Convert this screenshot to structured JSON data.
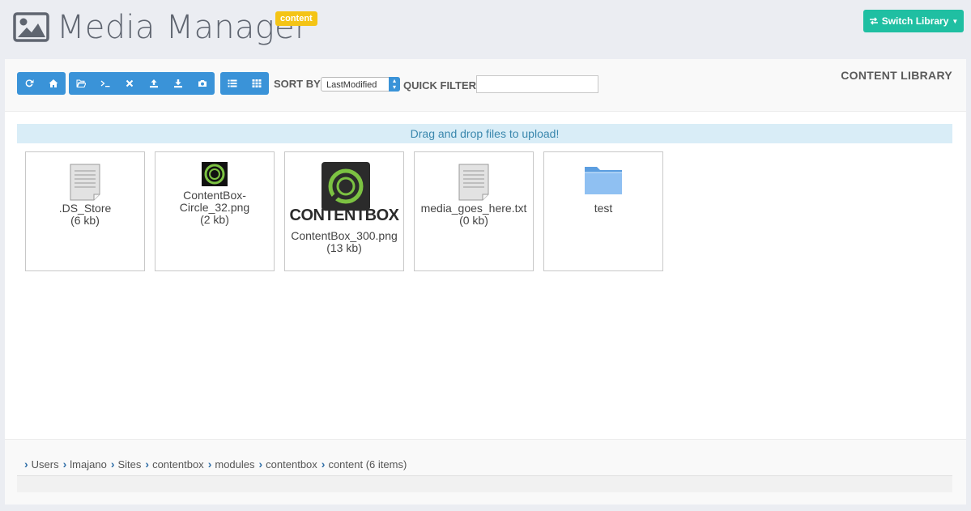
{
  "header": {
    "title": "Media Manager",
    "badge": "content",
    "switch_label": "Switch Library"
  },
  "toolbar": {
    "groups": [
      [
        "refresh-icon",
        "home-icon"
      ],
      [
        "folder-open-icon",
        "terminal-icon",
        "remove-icon",
        "upload-icon",
        "download-icon",
        "camera-icon"
      ],
      [
        "list-view-icon",
        "grid-view-icon"
      ]
    ],
    "sort_label": "SORT BY",
    "sort_value": "LastModified",
    "quick_filter_label": "QUICK FILTER",
    "quick_filter_value": "",
    "library_label": "CONTENT LIBRARY",
    "accent_color": "#3a93d8"
  },
  "dropzone": {
    "text": "Drag and drop files to upload!"
  },
  "files": [
    {
      "name": ".DS_Store",
      "size": "(6 kb)",
      "icon": "document-icon"
    },
    {
      "name": "ContentBox-Circle_32.png",
      "size": "(2 kb)",
      "icon": "image-thumbnail"
    },
    {
      "name": "ContentBox_300.png",
      "size": "(13 kb)",
      "icon": "image-thumbnail"
    },
    {
      "name": "media_goes_here.txt",
      "size": "(0 kb)",
      "icon": "document-icon"
    },
    {
      "name": "test",
      "size": "",
      "icon": "folder-icon"
    }
  ],
  "thumbnail_text": "CONTENTBOX",
  "breadcrumb": [
    {
      "label": "Users"
    },
    {
      "label": "lmajano"
    },
    {
      "label": "Sites"
    },
    {
      "label": "contentbox"
    },
    {
      "label": "modules"
    },
    {
      "label": "contentbox"
    },
    {
      "label": "content (6 items)"
    }
  ]
}
